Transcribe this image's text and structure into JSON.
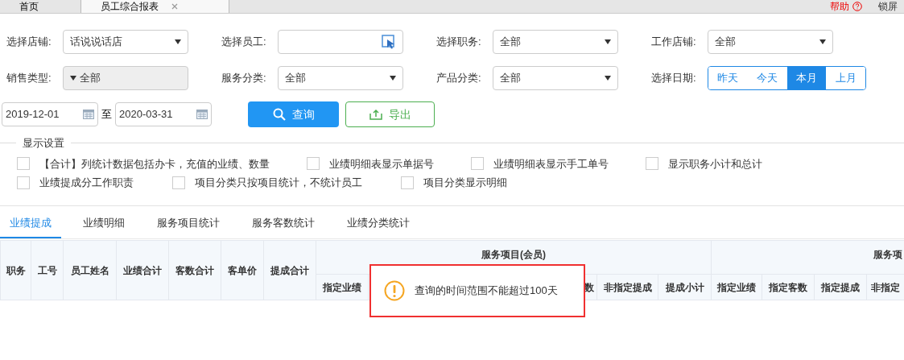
{
  "top_tabs": [
    {
      "label": "首页",
      "selected": false,
      "closable": false
    },
    {
      "label": "员工综合报表",
      "selected": true,
      "closable": true
    }
  ],
  "top_right": {
    "help": "帮助",
    "lock": "锁屏"
  },
  "filters": [
    [
      {
        "label": "选择店铺:",
        "kind": "select",
        "value": "话说说话店"
      },
      {
        "label": "选择员工:",
        "kind": "picker"
      },
      {
        "label": "选择职务:",
        "kind": "select",
        "value": "全部"
      },
      {
        "label": "工作店铺:",
        "kind": "select",
        "value": "全部"
      }
    ],
    [
      {
        "label": "销售类型:",
        "kind": "multiselect",
        "value": "全部"
      },
      {
        "label": "服务分类:",
        "kind": "select",
        "value": "全部"
      },
      {
        "label": "产品分类:",
        "kind": "select",
        "value": "全部"
      },
      {
        "label": "选择日期:",
        "kind": "quick",
        "options": [
          {
            "label": "昨天",
            "selected": false
          },
          {
            "label": "今天",
            "selected": false
          },
          {
            "label": "本月",
            "selected": true
          },
          {
            "label": "上月",
            "selected": false
          }
        ]
      }
    ]
  ],
  "date_from": "2019-12-01",
  "date_sep": "至",
  "date_to": "2020-03-31",
  "query_button": "查询",
  "export_button": "导出",
  "display_settings": {
    "title": "显示设置",
    "rows": [
      [
        {
          "label": "【合计】列统计数据包括办卡，充值的业绩、数量",
          "checked": false
        },
        {
          "label": "业绩明细表显示单据号",
          "checked": false
        },
        {
          "label": "业绩明细表显示手工单号",
          "checked": false
        },
        {
          "label": "显示职务小计和总计",
          "checked": false
        }
      ],
      [
        {
          "label": "业绩提成分工作职责",
          "checked": false
        },
        {
          "label": "项目分类只按项目统计，不统计员工",
          "checked": false
        },
        {
          "label": "项目分类显示明细",
          "checked": false
        }
      ]
    ]
  },
  "report_tabs": [
    {
      "label": "业绩提成",
      "selected": true
    },
    {
      "label": "业绩明细",
      "selected": false
    },
    {
      "label": "服务项目统计",
      "selected": false
    },
    {
      "label": "服务客数统计",
      "selected": false
    },
    {
      "label": "业绩分类统计",
      "selected": false
    }
  ],
  "table": {
    "columns": [
      "职务",
      "工号",
      "员工姓名",
      "业绩合计",
      "客数合计",
      "客单价",
      "提成合计"
    ],
    "groups": [
      {
        "label": "服务项目(会员)",
        "sub_columns": [
          "指定业绩",
          null,
          null,
          null,
          "数",
          "非指定提成",
          "提成小计"
        ]
      },
      {
        "label": "服务项",
        "sub_columns": [
          "指定业绩",
          "指定客数",
          "指定提成",
          "非指定"
        ]
      }
    ]
  },
  "toast": {
    "message": "查询的时间范围不能超过100天"
  }
}
